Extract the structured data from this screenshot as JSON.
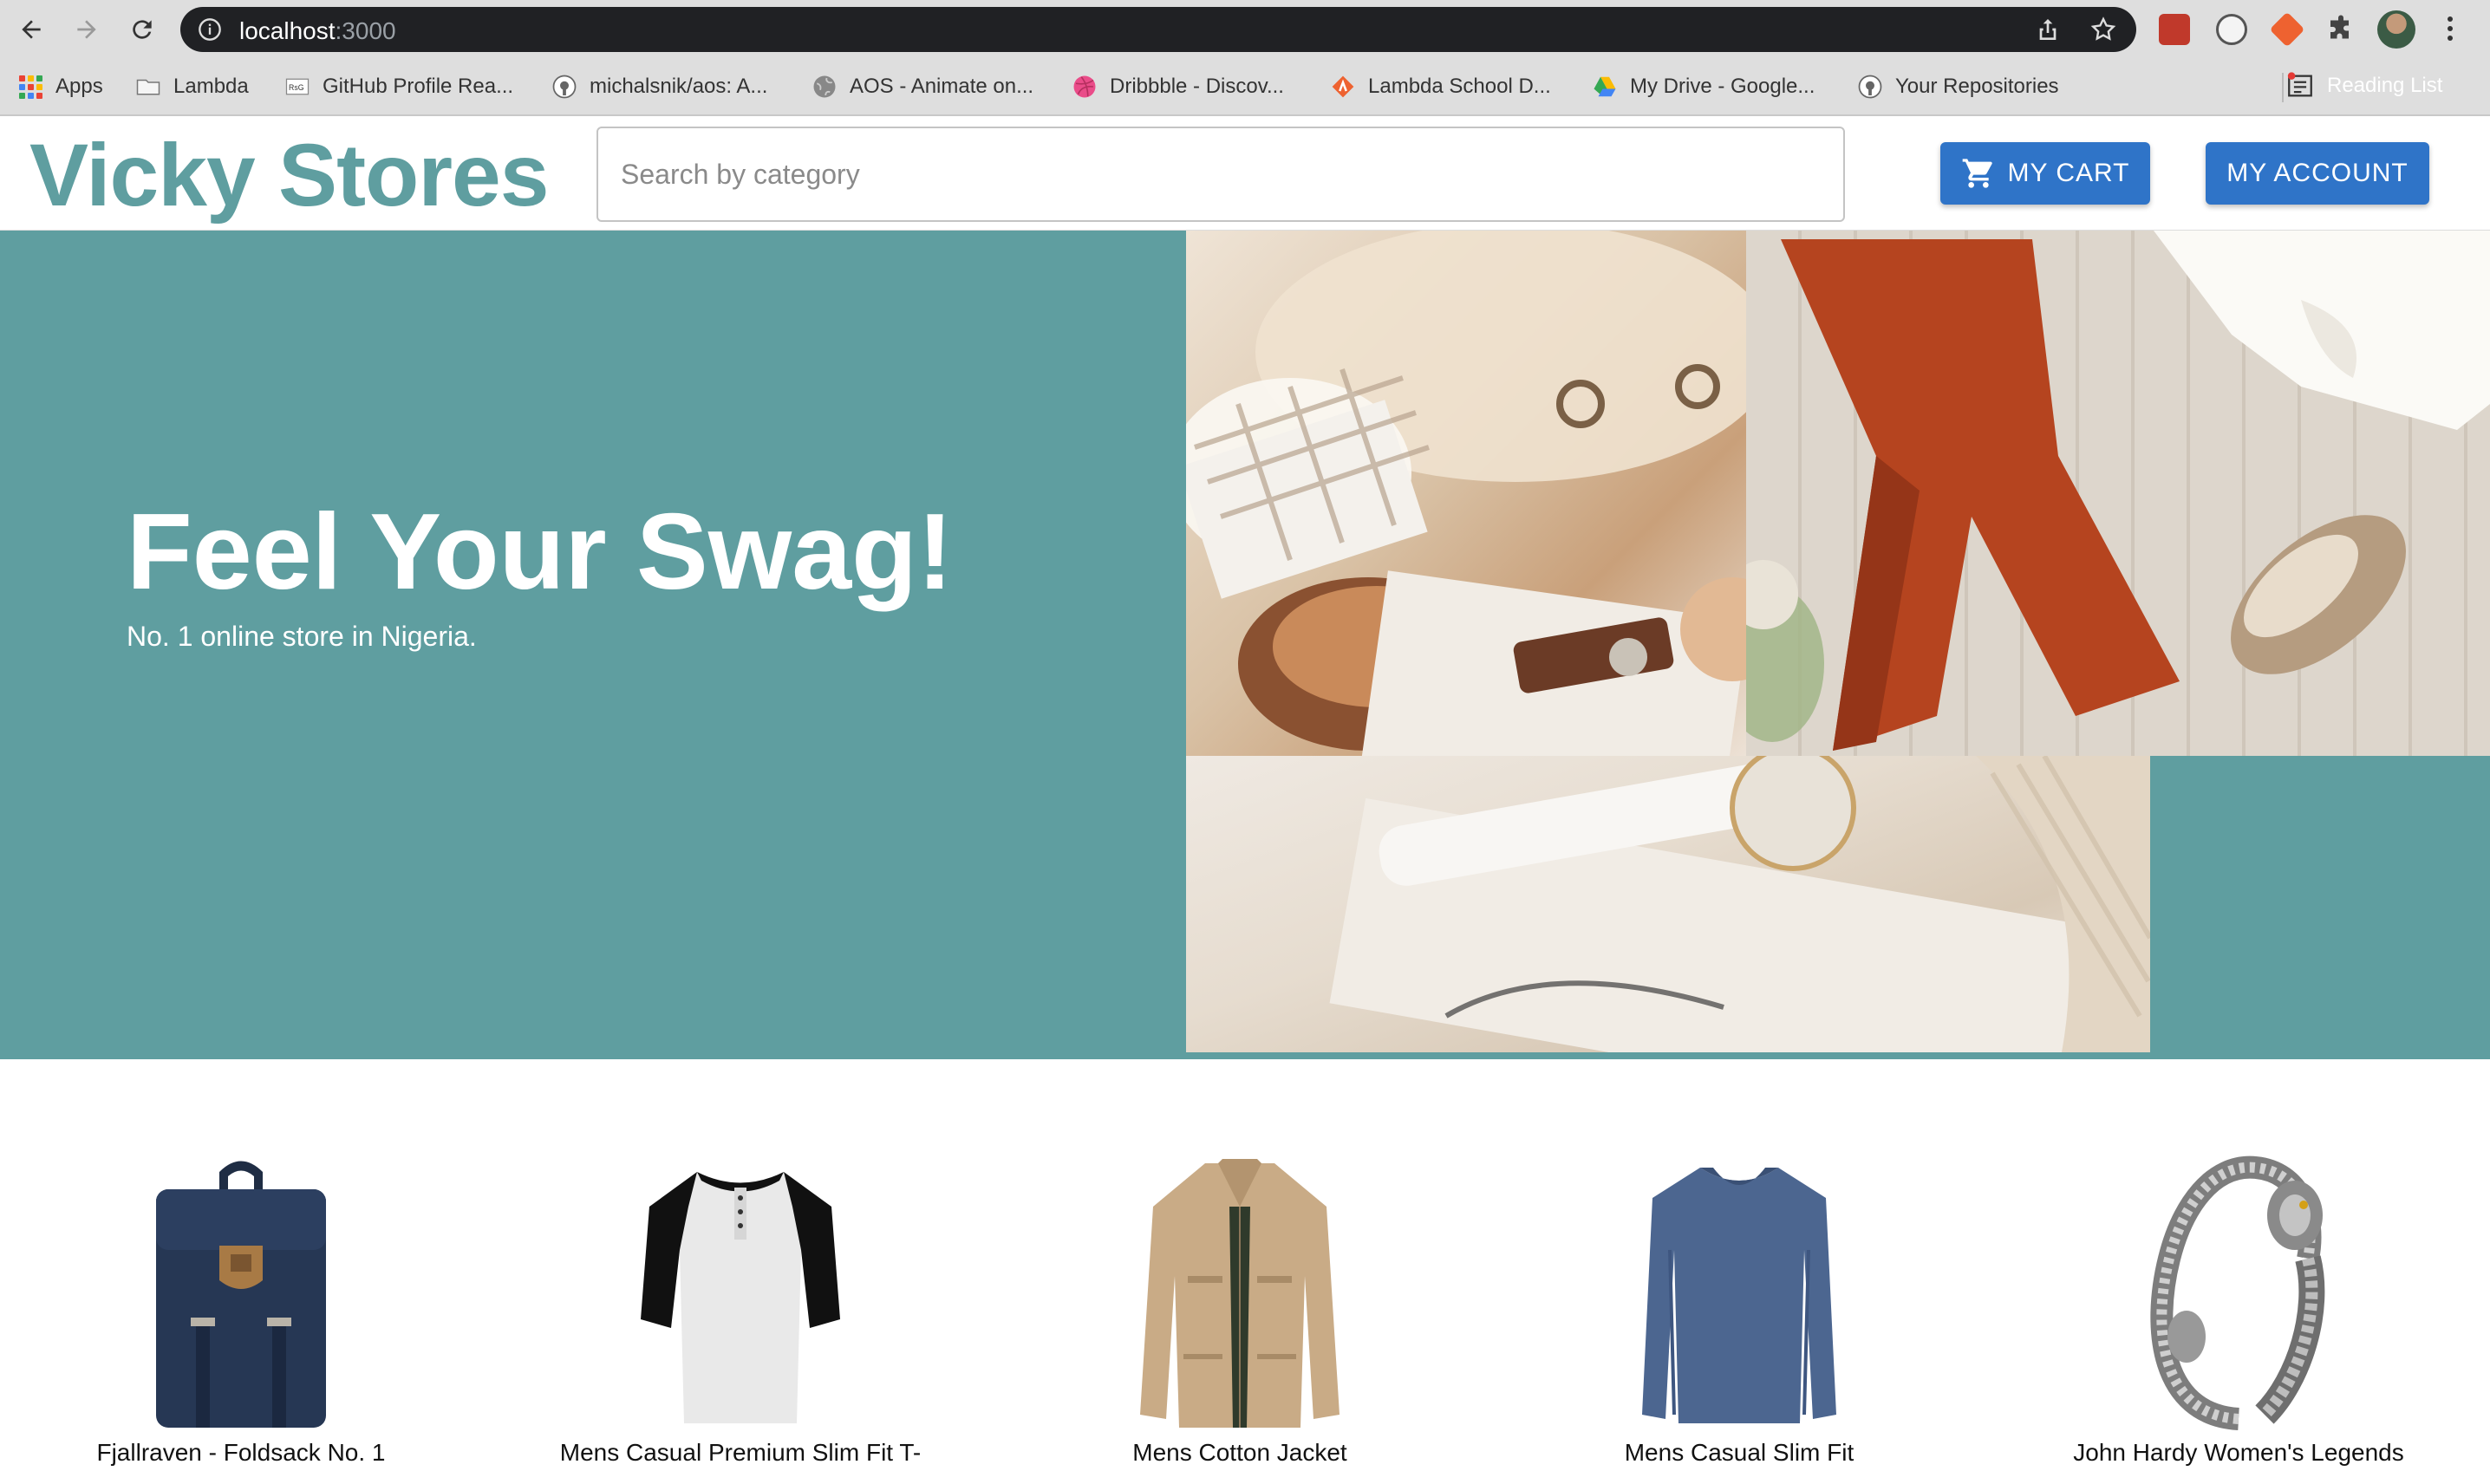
{
  "browser": {
    "url_host": "localhost",
    "url_port": ":3000",
    "bookmarks": [
      {
        "label": "Apps",
        "icon": "apps-grid-icon"
      },
      {
        "label": "Lambda",
        "icon": "folder-icon"
      },
      {
        "label": "GitHub Profile Rea...",
        "icon": "github-readme-icon"
      },
      {
        "label": "michalsnik/aos: A...",
        "icon": "github-icon"
      },
      {
        "label": "AOS - Animate on...",
        "icon": "globe-icon"
      },
      {
        "label": "Dribbble - Discov...",
        "icon": "dribbble-icon"
      },
      {
        "label": "Lambda School D...",
        "icon": "lambda-icon"
      },
      {
        "label": "My Drive - Google...",
        "icon": "google-drive-icon"
      },
      {
        "label": "Your Repositories",
        "icon": "github-icon"
      }
    ],
    "reading_list": "Reading List"
  },
  "header": {
    "logo": "Vicky Stores",
    "search_placeholder": "Search by category",
    "cart_label": "MY CART",
    "account_label": "MY ACCOUNT"
  },
  "hero": {
    "title": "Feel Your Swag!",
    "subtitle": "No. 1 online store in Nigeria."
  },
  "products": [
    {
      "name": "Fjallraven - Foldsack No. 1",
      "icon": "backpack-icon"
    },
    {
      "name": "Mens Casual Premium Slim Fit T-",
      "icon": "tshirt-icon"
    },
    {
      "name": "Mens Cotton Jacket",
      "icon": "jacket-icon"
    },
    {
      "name": "Mens Casual Slim Fit",
      "icon": "longsleeve-icon"
    },
    {
      "name": "John Hardy Women's Legends",
      "icon": "bracelet-icon"
    }
  ],
  "colors": {
    "brand": "#5f9ea0",
    "button": "#2f74c8",
    "omnibox": "#202124"
  }
}
